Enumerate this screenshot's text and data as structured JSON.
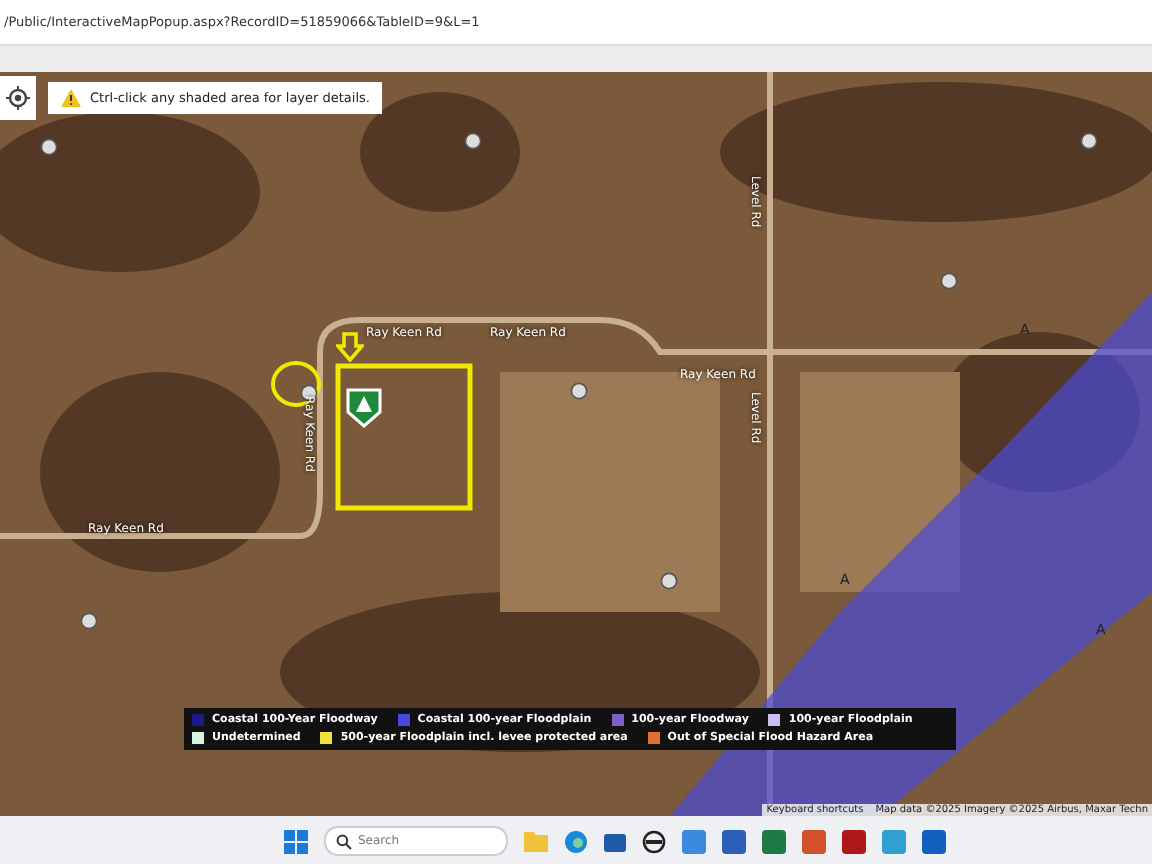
{
  "address_bar": {
    "url": "/Public/InteractiveMapPopup.aspx?RecordID=51859066&TableID=9&L=1"
  },
  "hint": {
    "text": "Ctrl-click any shaded area for layer details."
  },
  "map": {
    "road_labels": [
      "Ray Keen Rd",
      "Ray Keen Rd",
      "Ray Keen Rd",
      "Ray Keen Rd",
      "Ray Keen Rd",
      "Level Rd",
      "Level Rd"
    ],
    "zone_labels": [
      "A",
      "A",
      "A"
    ]
  },
  "legend": [
    {
      "label": "Coastal 100-Year Floodway",
      "color": "#1a1a8c"
    },
    {
      "label": "Coastal 100-year Floodplain",
      "color": "#4848e0"
    },
    {
      "label": "100-year Floodway",
      "color": "#8060c8"
    },
    {
      "label": "100-year Floodplain",
      "color": "#cdbff0"
    },
    {
      "label": "Undetermined",
      "color": "#d8f2e2"
    },
    {
      "label": "500-year Floodplain incl. levee protected area",
      "color": "#f0e040"
    },
    {
      "label": "Out of Special Flood Hazard Area",
      "color": "#e07030"
    }
  ],
  "attribution": [
    "Keyboard shortcuts",
    "Map data ©2025 Imagery ©2025 Airbus, Maxar Techn"
  ],
  "taskbar": {
    "search_placeholder": "Search"
  }
}
